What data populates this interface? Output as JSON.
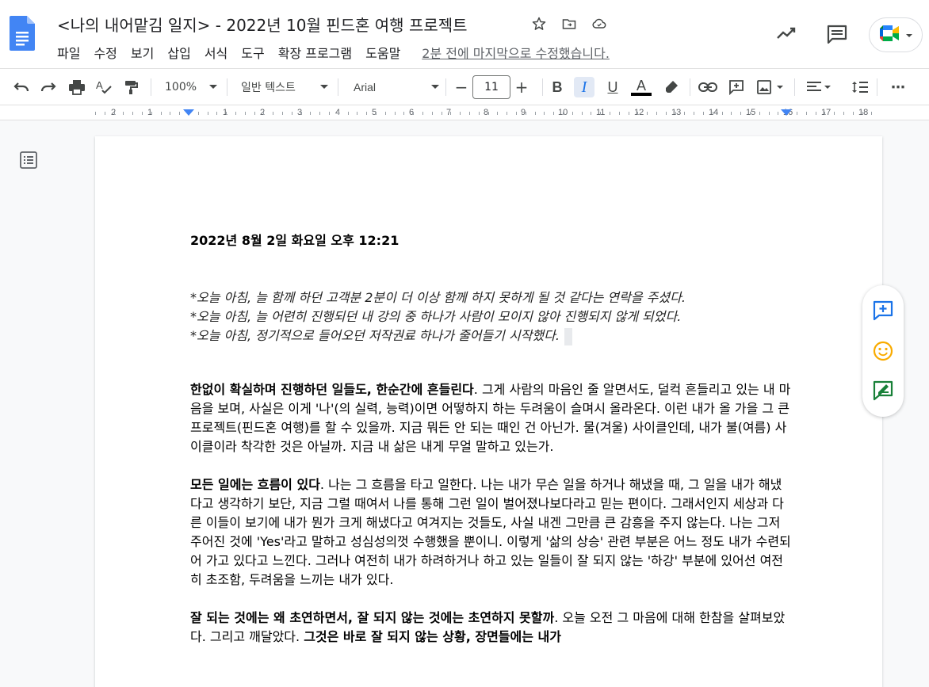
{
  "document": {
    "title": "<나의 내어맡김 일지> - 2022년 10월 핀드혼 여행 프로젝트",
    "last_edit": "2분 전에 마지막으로 수정했습니다."
  },
  "menu": [
    "파일",
    "수정",
    "보기",
    "삽입",
    "서식",
    "도구",
    "확장 프로그램",
    "도움말"
  ],
  "toolbar": {
    "zoom": "100%",
    "style": "일반 텍스트",
    "font": "Arial",
    "font_size": "11",
    "minus": "−",
    "plus": "+",
    "bold": "B",
    "italic": "I",
    "underline": "U",
    "text_color": "A",
    "more": "⋯"
  },
  "ruler": {
    "numbers": [
      "2",
      "1",
      "1",
      "2",
      "3",
      "4",
      "5",
      "6",
      "7",
      "8",
      "9",
      "10",
      "11",
      "12",
      "13",
      "14",
      "15",
      "16",
      "17",
      "18"
    ]
  },
  "content": {
    "date": "2022년 8월 2일 화요일 오후 12:21",
    "italic_lines": [
      "*오늘 아침, 늘 함께 하던 고객분 2분이 더 이상 함께 하지 못하게 될 것 같다는 연락을 주셨다.",
      "*오늘 아침, 늘 어련히 진행되던 내 강의 중 하나가 사람이 모이지 않아 진행되지 않게 되었다.",
      "*오늘 아침, 정기적으로 들어오던 저작권료 하나가 줄어들기 시작했다."
    ],
    "p1_bold": "한없이 확실하며 진행하던 일들도, 한순간에 흔들린다",
    "p1_rest": ". 그게 사람의 마음인 줄 알면서도, 덜컥 흔들리고 있는 내 마음을 보며, 사실은 이게 '나'(의 실력, 능력)이면 어떻하지 하는 두려움이 슬며시 올라온다. 이런 내가 올 가을 그 큰 프로젝트(핀드혼 여행)를 할 수 있을까. 지금 뭐든 안 되는 때인 건 아닌가. 물(겨울) 사이클인데, 내가 불(여름) 사이클이라 착각한 것은 아닐까. 지금 내 삶은 내게 무얼 말하고 있는가.",
    "p2_bold": "모든 일에는 흐름이 있다",
    "p2_rest": ". 나는 그 흐름을 타고 일한다. 나는 내가 무슨 일을 하거나 해냈을 때, 그 일을 내가 해냈다고 생각하기 보단, 지금 그럴 때여서 나를 통해 그런 일이 벌어졌나보다라고 믿는 편이다. 그래서인지 세상과 다른 이들이 보기에 내가 뭔가 크게 해냈다고 여겨지는 것들도, 사실 내겐 그만큼 큰 감흥을 주지 않는다. 나는 그저 주어진 것에 'Yes'라고 말하고 성심성의껏 수행했을 뿐이니. 이렇게 '삶의 상승' 관련 부분은 어느 정도 내가 수련되어 가고 있다고 느낀다. 그러나 여전히 내가 하려하거나 하고 있는 일들이 잘 되지 않는 '하강' 부분에 있어선 여전히 초조함, 두려움을 느끼는 내가 있다.",
    "p3_bold": "잘 되는 것에는 왜 초연하면서, 잘 되지 않는 것에는 초연하지 못할까",
    "p3_rest": ". 오늘 오전 그 마음에 대해 한참을 살펴보았다. 그리고 깨달았다. ",
    "p3_bold2": "그것은 바로 잘 되지 않는 상황, 장면들에는 내가"
  },
  "colors": {
    "accent_blue": "#4285f4",
    "docs_blue": "#4285f4",
    "side_icons": "#1a73e8",
    "emoji_yellow": "#f9ab00"
  }
}
